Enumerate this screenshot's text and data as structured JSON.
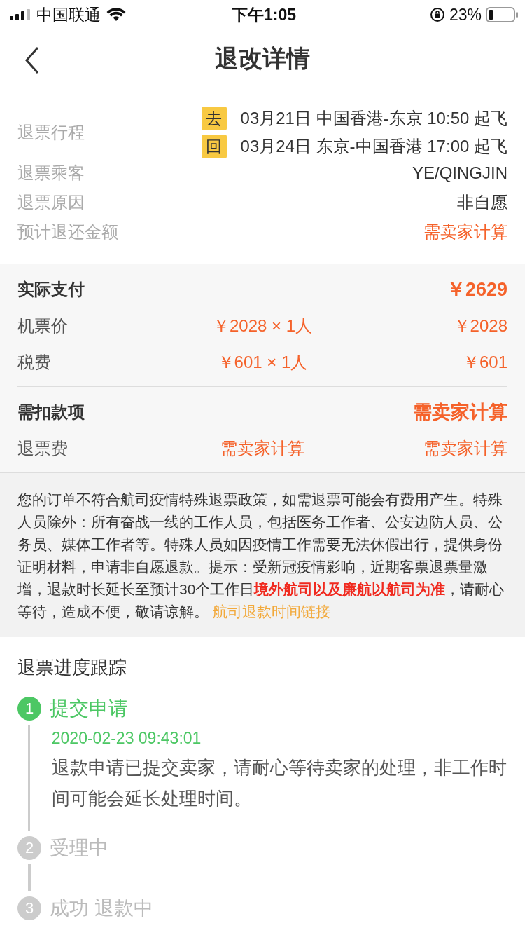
{
  "status_bar": {
    "carrier": "中国联通",
    "time": "下午1:05",
    "battery": "23%"
  },
  "nav": {
    "title": "退改详情"
  },
  "summary": {
    "trip_label": "退票行程",
    "flights": [
      {
        "badge": "去",
        "text": "03月21日 中国香港-东京 10:50 起飞"
      },
      {
        "badge": "回",
        "text": "03月24日 东京-中国香港 17:00 起飞"
      }
    ],
    "rows": [
      {
        "label": "退票乘客",
        "value": "YE/QINGJIN",
        "kind": "plain"
      },
      {
        "label": "退票原因",
        "value": "非自愿",
        "kind": "plain"
      },
      {
        "label": "预计退还金额",
        "value": "需卖家计算",
        "kind": "accent"
      }
    ]
  },
  "payment": {
    "groups": [
      {
        "title": "实际支付",
        "total": "￥2629",
        "items": [
          {
            "label": "机票价",
            "unit": "￥2028 × 1人",
            "amount": "￥2028"
          },
          {
            "label": "税费",
            "unit": "￥601 × 1人",
            "amount": "￥601"
          }
        ]
      },
      {
        "title": "需扣款项",
        "total": "需卖家计算",
        "items": [
          {
            "label": "退票费",
            "unit": "需卖家计算",
            "amount": "需卖家计算"
          }
        ]
      }
    ]
  },
  "notice": {
    "text": "您的订单不符合航司疫情特殊退票政策，如需退票可能会有费用产生。特殊人员除外：所有奋战一线的工作人员，包括医务工作者、公安边防人员、公务员、媒体工作者等。特殊人员如因疫情工作需要无法休假出行，提供身份证明材料，申请非自愿退款。提示：受新冠疫情影响，近期客票退票量激增，退款时长延长至预计30个工作日**境外航司以及廉航以航司为准**，请耐心等待，造成不便，敬请谅解。",
    "link": "航司退款时间链接"
  },
  "progress": {
    "title": "退票进度跟踪",
    "steps": [
      {
        "number": "1",
        "label": "提交申请",
        "active": true,
        "time": "2020-02-23 09:43:01",
        "description": "退款申请已提交卖家，请耐心等待卖家的处理，非工作时间可能会延长处理时间。"
      },
      {
        "number": "2",
        "label": "受理中",
        "active": false
      },
      {
        "number": "3",
        "label": "成功 退款中",
        "active": false
      }
    ]
  }
}
